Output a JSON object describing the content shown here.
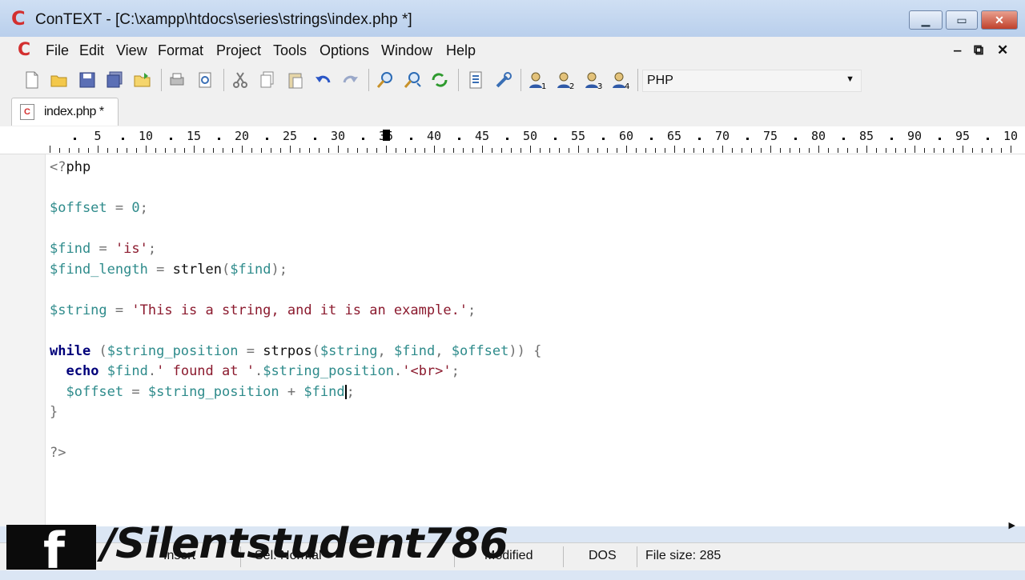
{
  "window": {
    "title": "ConTEXT - [C:\\xampp\\htdocs\\series\\strings\\index.php *]"
  },
  "menu": {
    "items": [
      "File",
      "Edit",
      "View",
      "Format",
      "Project",
      "Tools",
      "Options",
      "Window",
      "Help"
    ]
  },
  "toolbar": {
    "language": "PHP"
  },
  "tabs": [
    {
      "label": "index.php *"
    }
  ],
  "ruler": {
    "numbers": [
      "5",
      "10",
      "15",
      "20",
      "25",
      "30",
      "35",
      "40",
      "45",
      "50",
      "55",
      "60",
      "65",
      "70",
      "75",
      "80",
      "85",
      "90",
      "95",
      "10"
    ],
    "cursor_column": 36
  },
  "editor": {
    "lines": [
      "<?php",
      "",
      "$offset = 0;",
      "",
      "$find = 'is';",
      "$find_length = strlen($find);",
      "",
      "$string = 'This is a string, and it is an example.';",
      "",
      "while ($string_position = strpos($string, $find, $offset)) {",
      "  echo $find.' found at '.$string_position.'<br>';",
      "  $offset = $string_position + $find;",
      "}",
      "",
      "?>"
    ]
  },
  "statusbar": {
    "insert": "Insert",
    "mode": "Sel: Normal",
    "modified": "Modified",
    "format": "DOS",
    "file_size": "File size: 285"
  },
  "watermark": {
    "text": "/Silentstudent786",
    "logo": "f"
  }
}
